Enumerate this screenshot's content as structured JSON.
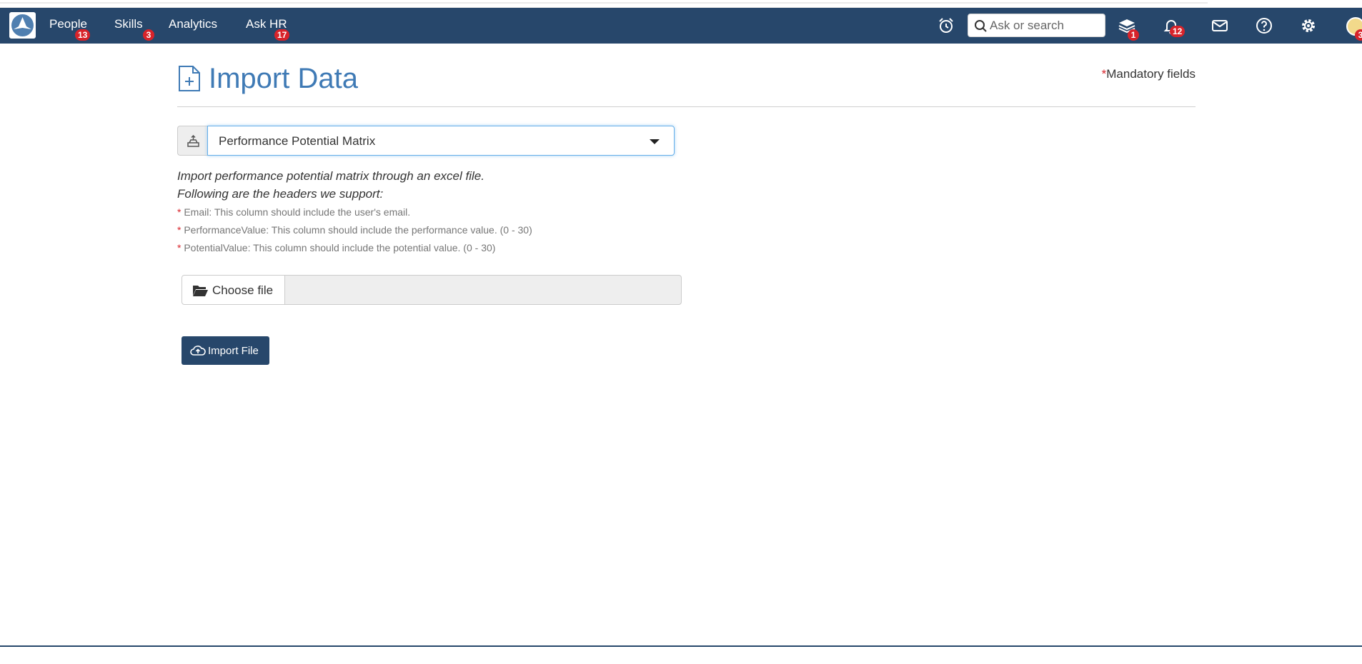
{
  "nav": {
    "items": [
      {
        "label": "People",
        "badge": "13"
      },
      {
        "label": "Skills",
        "badge": "3"
      },
      {
        "label": "Analytics"
      },
      {
        "label": "Ask HR",
        "badge": "17"
      }
    ],
    "search_placeholder": "Ask or search",
    "icons": {
      "alarm": "alarm-clock-icon",
      "learning": "layers-icon",
      "notifications": "bell-icon",
      "messages": "envelope-icon",
      "help": "question-circle-icon",
      "settings": "gear-icon"
    },
    "learning_badge": "1",
    "notifications_badge": "12",
    "avatar_badge": "3",
    "colors": {
      "navbar": "#27476b",
      "badge": "#d8232a",
      "title": "#3f7ab5"
    }
  },
  "page": {
    "title": "Import Data",
    "mandatory_star": "*",
    "mandatory_label": "Mandatory fields"
  },
  "import_type": {
    "selected": "Performance Potential Matrix"
  },
  "instructions": {
    "line1": "Import performance potential matrix through an excel file.",
    "line2": "Following are the headers we support:",
    "headers": [
      "Email: This column should include the user's email.",
      "PerformanceValue: This column should include the performance value. (0 - 30)",
      "PotentialValue: This column should include the potential value. (0 - 30)"
    ]
  },
  "file": {
    "choose_label": "Choose file",
    "value": ""
  },
  "actions": {
    "import_label": "Import File"
  }
}
